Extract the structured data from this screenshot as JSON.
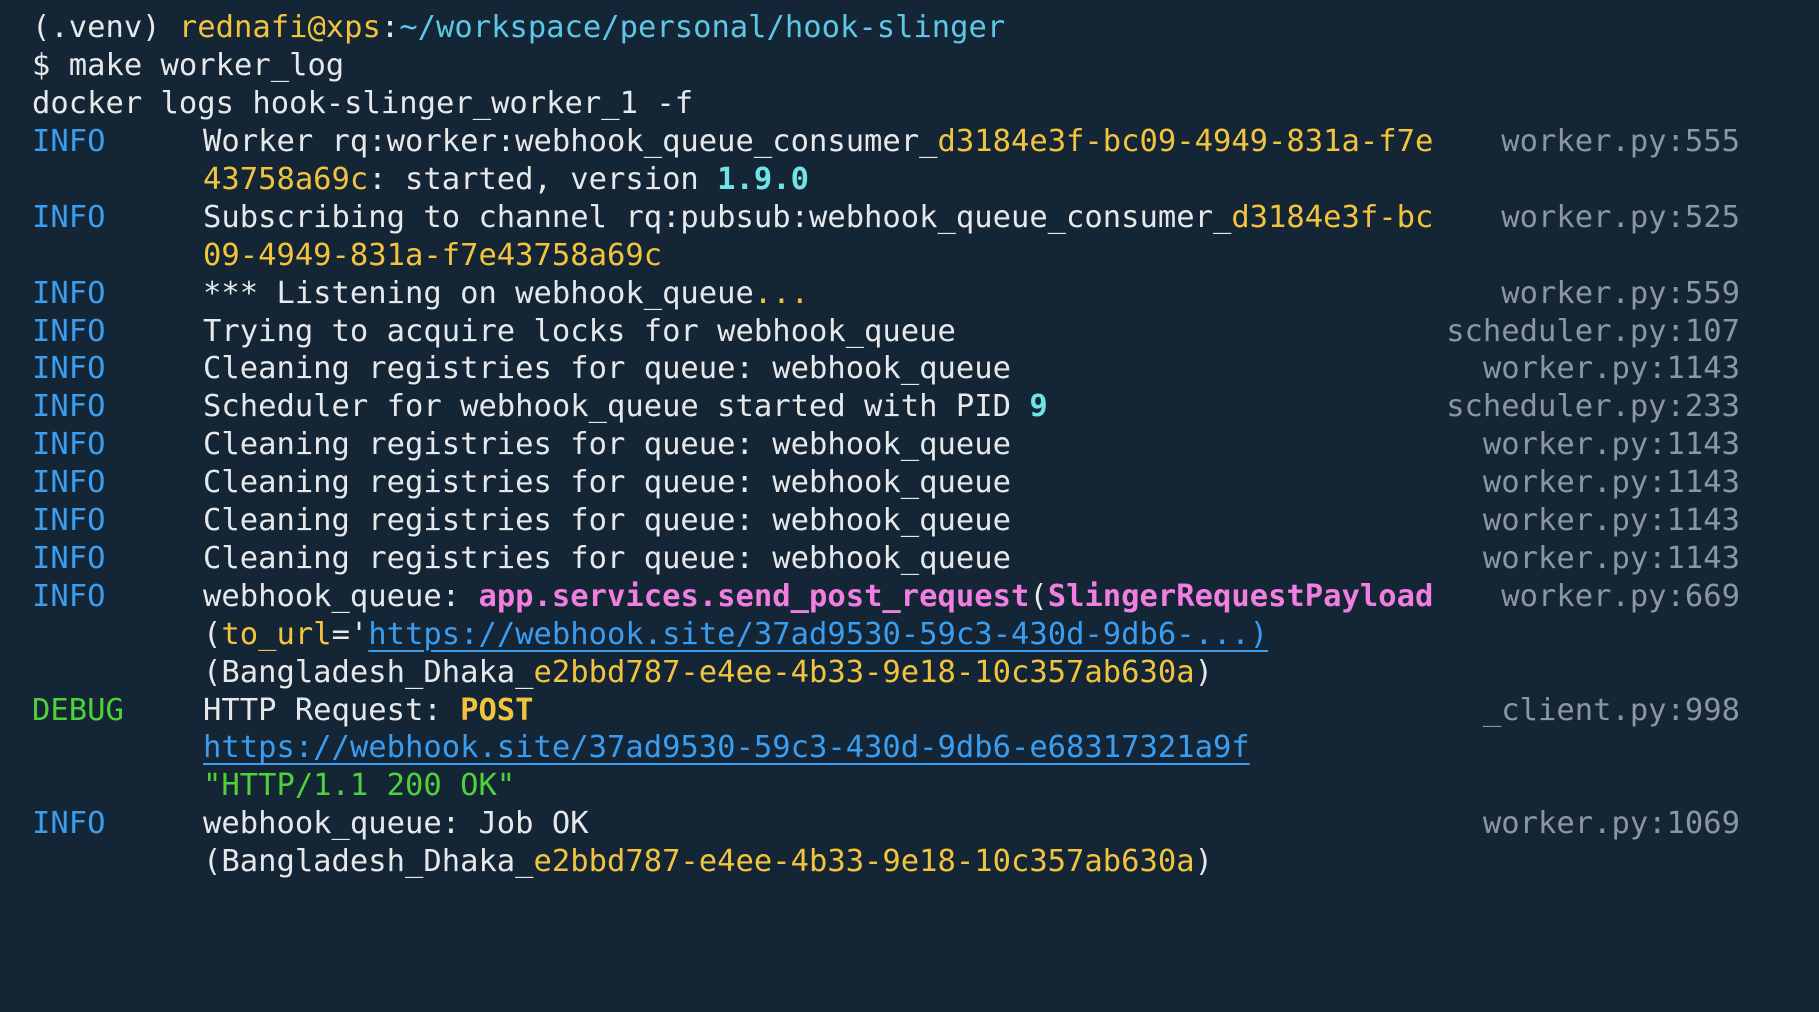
{
  "prompt": {
    "venv": "(.venv) ",
    "user_host": "rednafi@xps",
    "colon": ":",
    "path": "~/workspace/personal/hook-slinger",
    "command_line": "$ make worker_log",
    "output_line": "docker logs hook-slinger_worker_1 -f"
  },
  "logs": [
    {
      "level": "INFO",
      "source": "worker.py:555",
      "lines": [
        [
          {
            "t": "Worker rq:worker:webhook_queue_consumer_"
          },
          {
            "t": "d3184e3f-bc09-4949-831a-f7e",
            "c": "yellow"
          }
        ],
        [
          {
            "t": "43758a69c",
            "c": "yellow"
          },
          {
            "t": ": started, version "
          },
          {
            "t": "1.9.0",
            "c": "cyan"
          }
        ]
      ]
    },
    {
      "level": "INFO",
      "source": "worker.py:525",
      "lines": [
        [
          {
            "t": "Subscribing to channel rq:pubsub:webhook_queue_consumer_"
          },
          {
            "t": "d3184e3f-bc",
            "c": "yellow"
          }
        ],
        [
          {
            "t": "09-4949-831a-f7e43758a69c",
            "c": "yellow"
          }
        ]
      ]
    },
    {
      "level": "INFO",
      "source": "worker.py:559",
      "lines": [
        [
          {
            "t": "*** Listening on webhook_queue"
          },
          {
            "t": "...",
            "c": "yellow"
          }
        ]
      ]
    },
    {
      "level": "INFO",
      "source": "scheduler.py:107",
      "lines": [
        [
          {
            "t": "Trying to acquire locks for webhook_queue"
          }
        ]
      ]
    },
    {
      "level": "INFO",
      "source": "worker.py:1143",
      "lines": [
        [
          {
            "t": "Cleaning registries for queue: webhook_queue"
          }
        ]
      ]
    },
    {
      "level": "INFO",
      "source": "scheduler.py:233",
      "lines": [
        [
          {
            "t": "Scheduler for webhook_queue started with PID "
          },
          {
            "t": "9",
            "c": "cyan"
          }
        ]
      ]
    },
    {
      "level": "INFO",
      "source": "worker.py:1143",
      "lines": [
        [
          {
            "t": "Cleaning registries for queue: webhook_queue"
          }
        ]
      ]
    },
    {
      "level": "INFO",
      "source": "worker.py:1143",
      "lines": [
        [
          {
            "t": "Cleaning registries for queue: webhook_queue"
          }
        ]
      ]
    },
    {
      "level": "INFO",
      "source": "worker.py:1143",
      "lines": [
        [
          {
            "t": "Cleaning registries for queue: webhook_queue"
          }
        ]
      ]
    },
    {
      "level": "INFO",
      "source": "worker.py:1143",
      "lines": [
        [
          {
            "t": "Cleaning registries for queue: webhook_queue"
          }
        ]
      ]
    },
    {
      "level": "INFO",
      "source": "worker.py:669",
      "lines": [
        [
          {
            "t": "webhook_queue: "
          },
          {
            "t": "app.services.send_post_request",
            "c": "magenta"
          },
          {
            "t": "("
          },
          {
            "t": "SlingerRequestPayload",
            "c": "magenta"
          }
        ],
        [
          {
            "t": "("
          },
          {
            "t": "to_url",
            "c": "yellow"
          },
          {
            "t": "='"
          },
          {
            "t": "https://webhook.site/37ad9530-59c3-430d-9db6-...)",
            "c": "link"
          }
        ],
        [
          {
            "t": "(Bangladesh_Dhaka_"
          },
          {
            "t": "e2bbd787-e4ee-4b33-9e18-10c357ab630a",
            "c": "yellow"
          },
          {
            "t": ")"
          }
        ]
      ]
    },
    {
      "level": "DEBUG",
      "source": "_client.py:998",
      "lines": [
        [
          {
            "t": "HTTP Request: "
          },
          {
            "t": "POST",
            "c": "bold-yellow"
          }
        ],
        [
          {
            "t": "https://webhook.site/37ad9530-59c3-430d-9db6-e68317321a9f",
            "c": "link"
          }
        ],
        [
          {
            "t": "\"HTTP/1.1 200 OK\"",
            "c": "green"
          }
        ]
      ]
    },
    {
      "level": "INFO",
      "source": "worker.py:1069",
      "lines": [
        [
          {
            "t": "webhook_queue: Job OK"
          }
        ],
        [
          {
            "t": "(Bangladesh_Dhaka_"
          },
          {
            "t": "e2bbd787-e4ee-4b33-9e18-10c357ab630a",
            "c": "yellow"
          },
          {
            "t": ")"
          }
        ]
      ]
    }
  ]
}
